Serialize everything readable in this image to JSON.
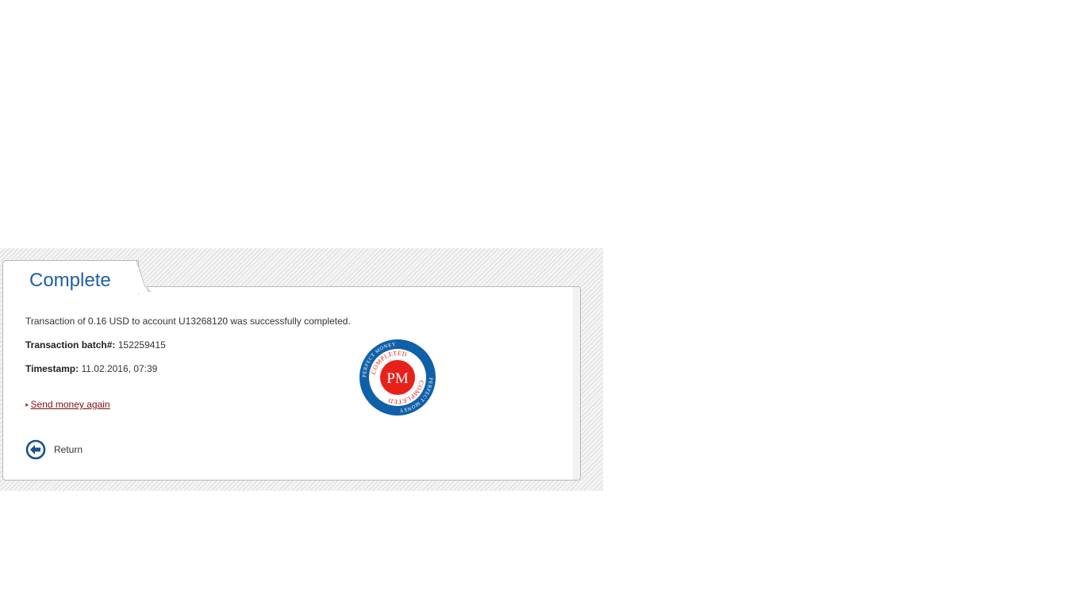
{
  "tab": {
    "title": "Complete"
  },
  "details": {
    "message": "Transaction of 0.16 USD to account U13268120 was successfully completed.",
    "batch_label": "Transaction batch#:",
    "batch_value": "152259415",
    "timestamp_label": "Timestamp:",
    "timestamp_value": "11.02.2016, 07:39"
  },
  "links": {
    "send_again": "Send money again"
  },
  "return": {
    "label": "Return",
    "icon": "arrow-left-circle-icon"
  },
  "seal": {
    "center": "PM",
    "ring_outer": "PERFECT MONEY",
    "ring_inner": "COMPLETED",
    "icon": "completed-seal-icon"
  },
  "colors": {
    "title": "#1f5fa3",
    "link": "#7a1010",
    "seal_blue": "#1060a8",
    "seal_red": "#e8201a"
  }
}
